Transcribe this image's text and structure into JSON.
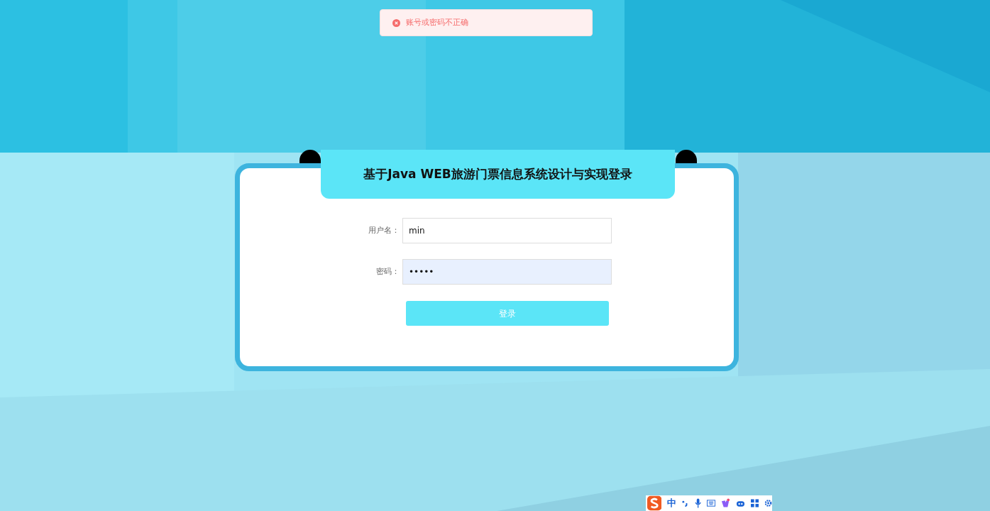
{
  "toast": {
    "message": "账号或密码不正确"
  },
  "login": {
    "title": "基于Java WEB旅游门票信息系统设计与实现登录",
    "fields": [
      {
        "label": "用户名：",
        "value": "min",
        "kind": "text"
      },
      {
        "label": "密码：",
        "value": "•••••",
        "kind": "password"
      }
    ],
    "submit": "登录"
  },
  "ime_toolbar": {
    "mode": "中"
  }
}
